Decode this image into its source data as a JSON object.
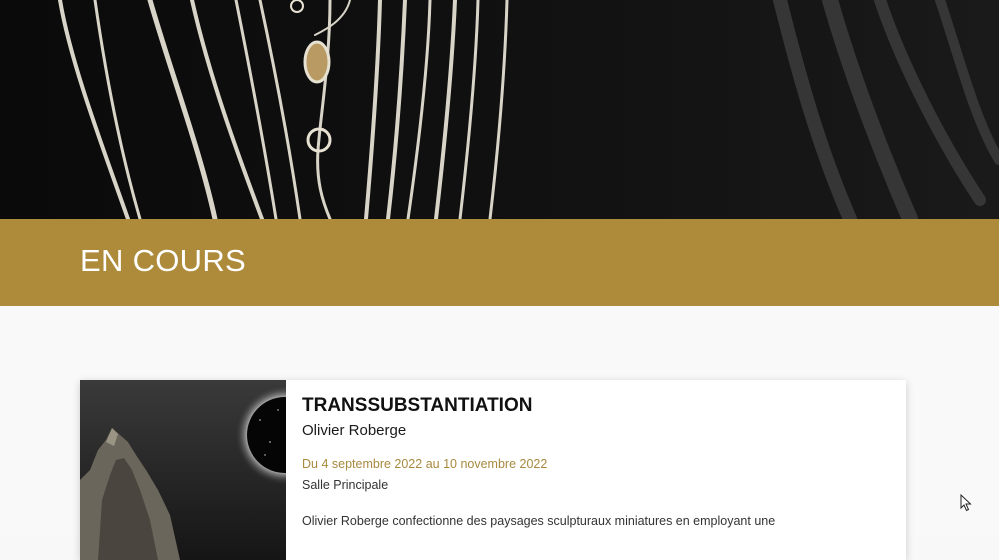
{
  "hero": {
    "image": "artwork-photo-strings"
  },
  "section": {
    "title": "EN COURS"
  },
  "exhibition": {
    "title": "TRANSSUBSTANTIATION",
    "artist": "Olivier Roberge",
    "dates": "Du 4 septembre 2022 au 10 novembre 2022",
    "room": "Salle Principale",
    "description": "Olivier Roberge confectionne des paysages sculpturaux miniatures en employant une",
    "thumbnail": "eclipse-landscape-image"
  },
  "colors": {
    "accent": "#ad8b3b",
    "date_text": "#a8893f",
    "hero_bg": "#0d0d0d",
    "page_bg": "#f9f9f9"
  },
  "cursor": {
    "icon": "mouse-pointer-icon"
  }
}
